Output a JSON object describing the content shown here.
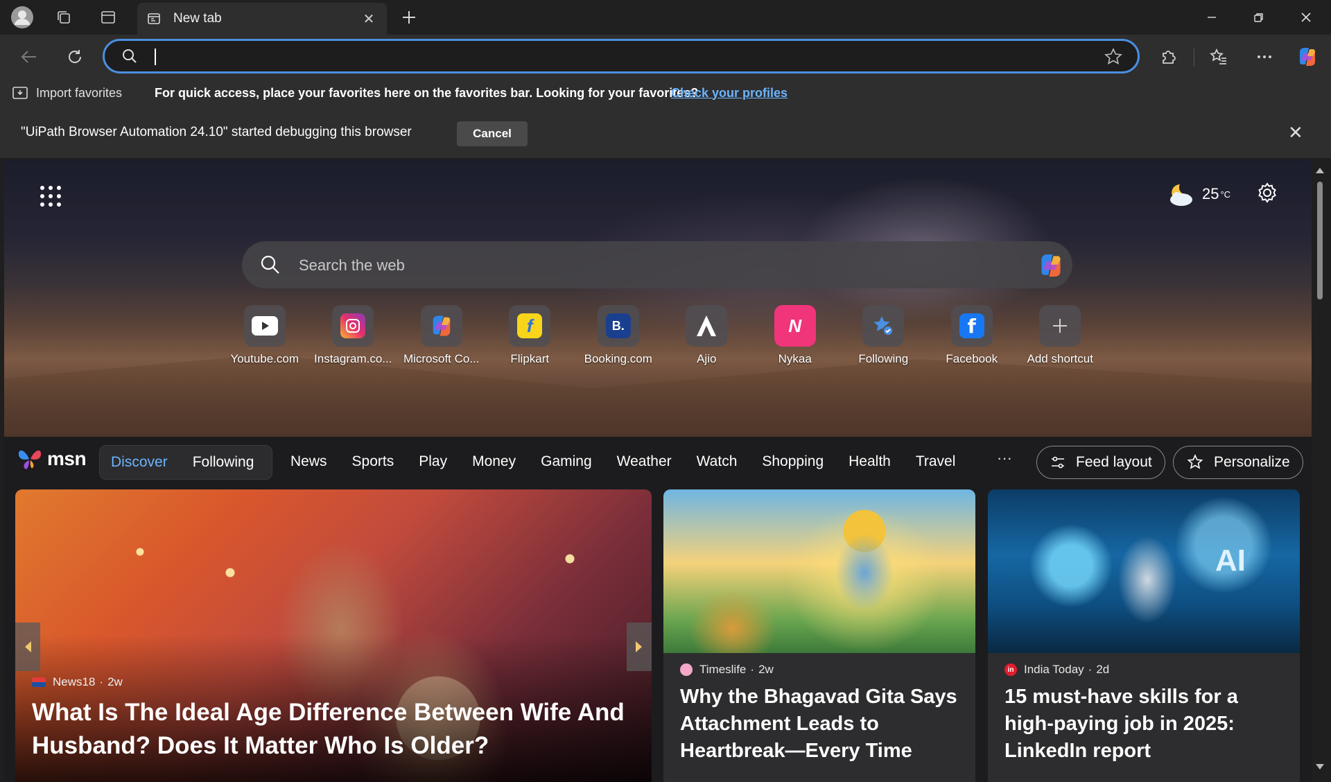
{
  "tab": {
    "title": "New tab"
  },
  "favorites_bar": {
    "import_label": "Import favorites",
    "message": "For quick access, place your favorites here on the favorites bar. Looking for your favorites?",
    "link": "Check your profiles"
  },
  "infobar": {
    "message": "\"UiPath Browser Automation 24.10\" started debugging this browser",
    "cancel_label": "Cancel"
  },
  "weather": {
    "temp": "25",
    "unit": "°C"
  },
  "search": {
    "placeholder": "Search the web"
  },
  "shortcuts": [
    {
      "label": "Youtube.com"
    },
    {
      "label": "Instagram.co..."
    },
    {
      "label": "Microsoft Co..."
    },
    {
      "label": "Flipkart"
    },
    {
      "label": "Booking.com"
    },
    {
      "label": "Ajio"
    },
    {
      "label": "Nykaa"
    },
    {
      "label": "Following"
    },
    {
      "label": "Facebook"
    },
    {
      "label": "Add shortcut"
    }
  ],
  "msn": {
    "logo_text": "msn",
    "pills": {
      "discover": "Discover",
      "following": "Following"
    },
    "nav": [
      "News",
      "Sports",
      "Play",
      "Money",
      "Gaming",
      "Weather",
      "Watch",
      "Shopping",
      "Health",
      "Travel"
    ],
    "more": "···",
    "feed_layout": "Feed layout",
    "personalize": "Personalize"
  },
  "cards": [
    {
      "source": "News18",
      "age": "2w",
      "title": "What Is The Ideal Age Difference Between Wife And Husband? Does It Matter Who Is Older?"
    },
    {
      "source": "Timeslife",
      "age": "2w",
      "title": "Why the Bhagavad Gita Says Attachment Leads to Heartbreak—Every Time"
    },
    {
      "source": "India Today",
      "age": "2d",
      "title": "15 must-have skills for a high-paying job in 2025: LinkedIn report",
      "image_text": "AI"
    }
  ],
  "colors": {
    "accent": "#4a8fe0",
    "link": "#6cb4ff",
    "discover": "#6cb4ff"
  }
}
